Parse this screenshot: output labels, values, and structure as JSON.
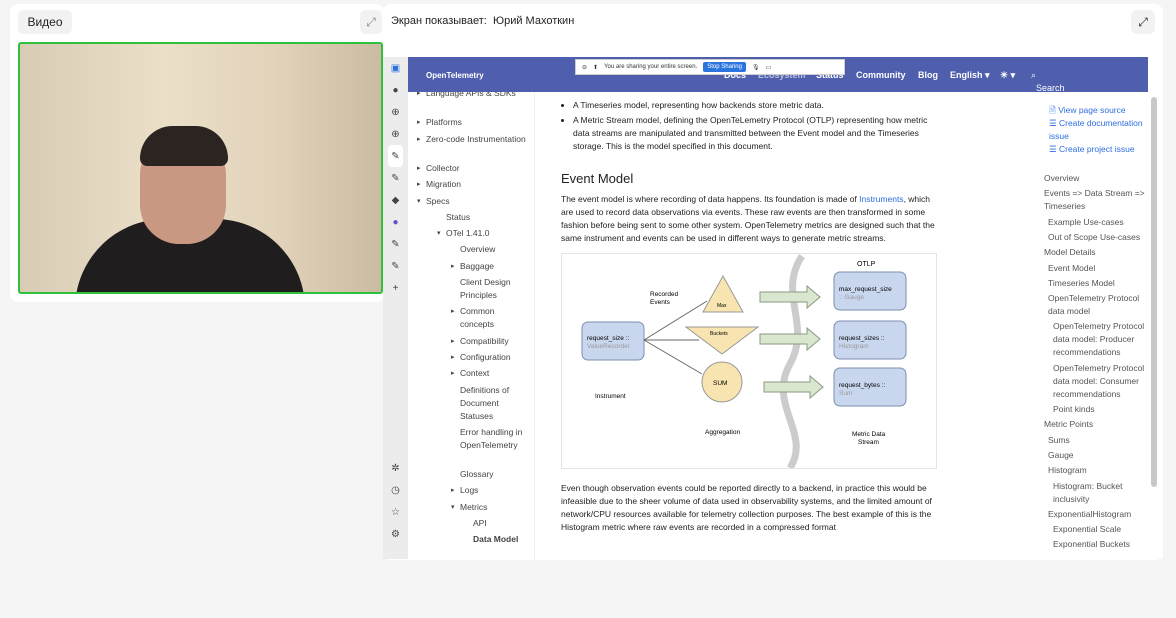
{
  "video_panel": {
    "label": "Видео"
  },
  "screen_panel": {
    "title": "Экран показывает:",
    "presenter": "Юрий Махоткин"
  },
  "banner": {
    "text": "You are sharing your entire screen.",
    "stop": "Stop Sharing"
  },
  "site": {
    "logo": "OpenTelemetry",
    "nav": [
      "Docs",
      "Ecosystem",
      "Status",
      "Community",
      "Blog",
      "English ▾",
      "☀ ▾"
    ],
    "search_placeholder": "Search this site..."
  },
  "left_nav": [
    {
      "t": "Language APIs & SDKs",
      "l": 1,
      "a": true
    },
    {
      "t": "Platforms",
      "l": 1,
      "a": true
    },
    {
      "t": "Zero-code Instrumentation",
      "l": 1,
      "a": true
    },
    {
      "t": "Collector",
      "l": 1,
      "a": true
    },
    {
      "t": "Migration",
      "l": 1,
      "a": true
    },
    {
      "t": "Specs",
      "l": 1,
      "o": true
    },
    {
      "t": "Status",
      "l": 2
    },
    {
      "t": "OTel 1.41.0",
      "l": 2,
      "o": true
    },
    {
      "t": "Overview",
      "l": 3
    },
    {
      "t": "Baggage",
      "l": 3,
      "a": true
    },
    {
      "t": "Client Design Principles",
      "l": 3
    },
    {
      "t": "Common concepts",
      "l": 3,
      "a": true
    },
    {
      "t": "Compatibility",
      "l": 3,
      "a": true
    },
    {
      "t": "Configuration",
      "l": 3,
      "a": true
    },
    {
      "t": "Context",
      "l": 3,
      "a": true
    },
    {
      "t": "Definitions of Document Statuses",
      "l": 3
    },
    {
      "t": "Error handling in OpenTelemetry",
      "l": 3
    },
    {
      "t": "Glossary",
      "l": 3
    },
    {
      "t": "Logs",
      "l": 3,
      "a": true
    },
    {
      "t": "Metrics",
      "l": 3,
      "o": true
    },
    {
      "t": "API",
      "l": 4
    },
    {
      "t": "Data Model",
      "l": 4,
      "b": true
    }
  ],
  "content": {
    "bullet1": "A Timeseries model, representing how backends store metric data.",
    "bullet2": "A Metric Stream model, defining the OpenTeLemetry Protocol (OTLP) representing how metric data streams are manipulated and transmitted between the Event model and the Timeseries storage. This is the model specified in this document.",
    "heading": "Event Model",
    "p1_before": "The event model is where recording of data happens. Its foundation is made of ",
    "p1_link": "Instruments",
    "p1_after": ", which are used to record data observations via events. These raw events are then transformed in some fashion before being sent to some other system. OpenTelemetry metrics are designed such that the same instrument and events can be used in different ways to generate metric streams.",
    "p2": "Even though observation events could be reported directly to a backend, in practice this would be infeasible due to the sheer volume of data used in observability systems, and the limited amount of network/CPU resources available for telemetry collection purposes. The best example of this is the Histogram metric where raw events are recorded in a compressed format"
  },
  "diagram": {
    "otlp": "OTLP",
    "recorded": "Recorded",
    "events": "Events",
    "instrument_name": "request_size ::",
    "instrument_type": "ValueRecorder",
    "instrument_label": "Instrument",
    "max": "Max",
    "buckets": "Buckets",
    "sum": "SUM",
    "aggregation": "Aggregation",
    "out": [
      {
        "n": "max_request_size",
        "t": ":: Gauge"
      },
      {
        "n": "request_sizes ::",
        "t": "Histogram"
      },
      {
        "n": "request_bytes ::",
        "t": "Sum"
      }
    ],
    "stream1": "Metric Data",
    "stream2": "Stream"
  },
  "toc_actions": [
    "View page source",
    "Create documentation issue",
    "Create project issue"
  ],
  "toc": [
    {
      "t": "Overview",
      "l": 0
    },
    {
      "t": "Events => Data Stream => Timeseries",
      "l": 0
    },
    {
      "t": "Example Use-cases",
      "l": 1
    },
    {
      "t": "Out of Scope Use-cases",
      "l": 1
    },
    {
      "t": "Model Details",
      "l": 0
    },
    {
      "t": "Event Model",
      "l": 1
    },
    {
      "t": "Timeseries Model",
      "l": 1
    },
    {
      "t": "OpenTelemetry Protocol data model",
      "l": 1
    },
    {
      "t": "OpenTelemetry Protocol data model: Producer recommendations",
      "l": 2
    },
    {
      "t": "OpenTelemetry Protocol data model: Consumer recommendations",
      "l": 2
    },
    {
      "t": "Point kinds",
      "l": 2
    },
    {
      "t": "Metric Points",
      "l": 0
    },
    {
      "t": "Sums",
      "l": 1
    },
    {
      "t": "Gauge",
      "l": 1
    },
    {
      "t": "Histogram",
      "l": 1
    },
    {
      "t": "Histogram: Bucket inclusivity",
      "l": 2
    },
    {
      "t": "ExponentialHistogram",
      "l": 1
    },
    {
      "t": "Exponential Scale",
      "l": 2
    },
    {
      "t": "Exponential Buckets",
      "l": 2
    }
  ]
}
